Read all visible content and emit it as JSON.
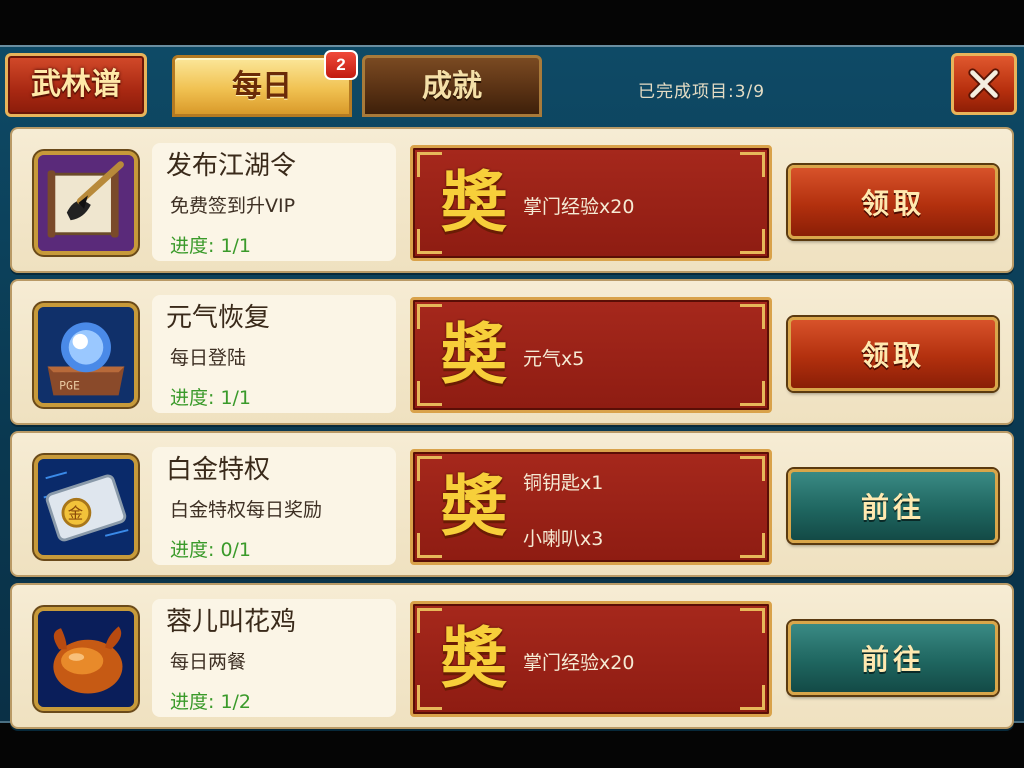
{
  "header": {
    "tabs": [
      {
        "label": "武林谱",
        "active": false
      },
      {
        "label": "每日",
        "active": true,
        "badge": "2"
      },
      {
        "label": "成就",
        "active": false
      }
    ],
    "progress": "已完成项目:3/9",
    "close_icon": "close-x-icon"
  },
  "reward_glyph": "奬",
  "tasks": [
    {
      "title": "发布江湖令",
      "desc": "免费签到升VIP",
      "progress": "进度: 1/1",
      "icon": "scroll-brush-icon",
      "rewards": [
        "掌门经验x20"
      ],
      "action": "领取",
      "action_type": "claim"
    },
    {
      "title": "元气恢复",
      "desc": "每日登陆",
      "progress": "进度: 1/1",
      "icon": "energy-orb-icon",
      "rewards": [
        "元气x5"
      ],
      "action": "领取",
      "action_type": "claim"
    },
    {
      "title": "白金特权",
      "desc": "白金特权每日奖励",
      "progress": "进度: 0/1",
      "icon": "gold-card-icon",
      "rewards": [
        "铜钥匙x1",
        "小喇叭x3"
      ],
      "action": "前往",
      "action_type": "go"
    },
    {
      "title": "蓉儿叫花鸡",
      "desc": "每日两餐",
      "progress": "进度: 1/2",
      "icon": "roast-chicken-icon",
      "rewards": [
        "掌门经验x20"
      ],
      "action": "前往",
      "action_type": "go"
    }
  ],
  "colors": {
    "frame": "#0a3850",
    "row_bg": "#f3e6c8",
    "reward_bg": "#9a2216",
    "claim_button": "#b2300e",
    "go_button": "#1f6660",
    "progress_text": "#3a9a2a",
    "reward_glyph": "#f7cf3a"
  }
}
